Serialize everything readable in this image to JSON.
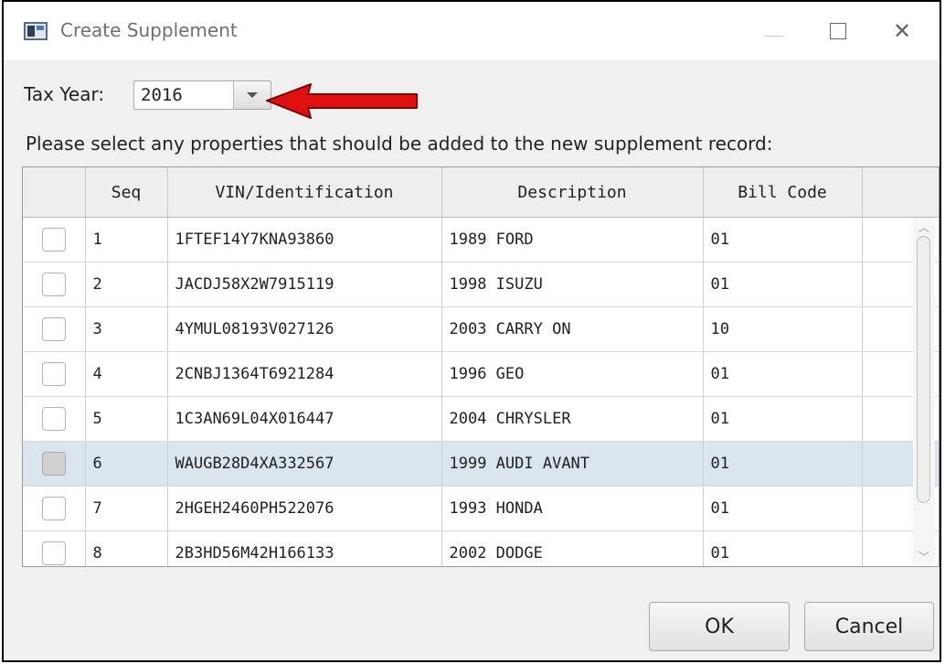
{
  "window": {
    "title": "Create Supplement",
    "close_glyph": "✕"
  },
  "tax_year": {
    "label": "Tax Year:",
    "value": "2016"
  },
  "instructions": "Please select any properties that should be added to the new supplement record:",
  "table": {
    "columns": [
      "",
      "Seq",
      "VIN/Identification",
      "Description",
      "Bill Code",
      ""
    ],
    "rows": [
      {
        "seq": "1",
        "vin": "1FTEF14Y7KNA93860",
        "description": "1989 FORD",
        "bill_code": "01"
      },
      {
        "seq": "2",
        "vin": "JACDJ58X2W7915119",
        "description": "1998 ISUZU",
        "bill_code": "01"
      },
      {
        "seq": "3",
        "vin": "4YMUL08193V027126",
        "description": "2003 CARRY ON",
        "bill_code": "10"
      },
      {
        "seq": "4",
        "vin": "2CNBJ1364T6921284",
        "description": "1996 GEO",
        "bill_code": "01"
      },
      {
        "seq": "5",
        "vin": "1C3AN69L04X016447",
        "description": "2004 CHRYSLER",
        "bill_code": "01"
      },
      {
        "seq": "6",
        "vin": "WAUGB28D4XA332567",
        "description": "1999 AUDI AVANT",
        "bill_code": "01"
      },
      {
        "seq": "7",
        "vin": "2HGEH2460PH522076",
        "description": "1993 HONDA",
        "bill_code": "01"
      },
      {
        "seq": "8",
        "vin": "2B3HD56M42H166133",
        "description": "2002 DODGE",
        "bill_code": "01"
      }
    ],
    "selected_row_seq": "6"
  },
  "buttons": {
    "ok": "OK",
    "cancel": "Cancel"
  },
  "colors": {
    "annotation_arrow": "#e01010",
    "selected_row": "#dbe5ee"
  },
  "icons": [
    "app-icon",
    "minimize-icon",
    "maximize-icon",
    "close-icon",
    "dropdown-arrow-icon",
    "red-arrow-annotation",
    "scroll-up-icon",
    "scroll-down-icon"
  ]
}
